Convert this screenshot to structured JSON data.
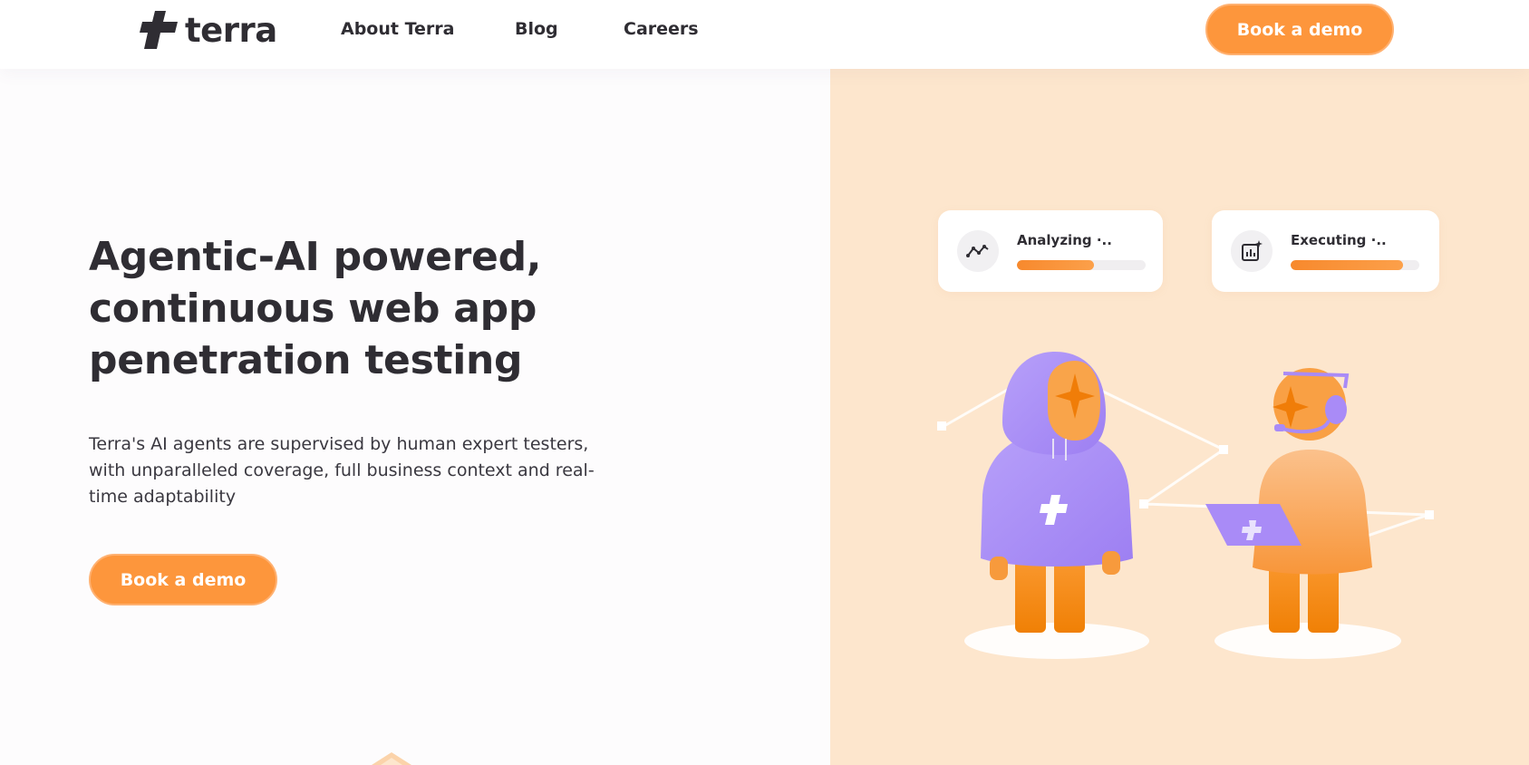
{
  "header": {
    "logo_text": "terra",
    "nav": [
      {
        "label": "About Terra"
      },
      {
        "label": "Blog"
      },
      {
        "label": "Careers"
      }
    ],
    "cta_label": "Book a demo"
  },
  "hero": {
    "title": "Agentic-AI powered, continuous web app penetration testing",
    "subtitle": "Terra's AI agents are supervised by human expert testers, with unparalleled coverage, full business context and real-time adaptability",
    "cta_label": "Book a demo"
  },
  "illustration": {
    "cards": [
      {
        "label": "Analyzing",
        "icon": "chart-line-icon",
        "progress": 0.6
      },
      {
        "label": "Executing",
        "icon": "bar-chart-sparkle-icon",
        "progress": 0.87
      }
    ]
  },
  "colors": {
    "accent": "#fd963c",
    "panel_bg": "#fde6cd",
    "hoodie": "#a98bf7",
    "text": "#2f2d33"
  }
}
